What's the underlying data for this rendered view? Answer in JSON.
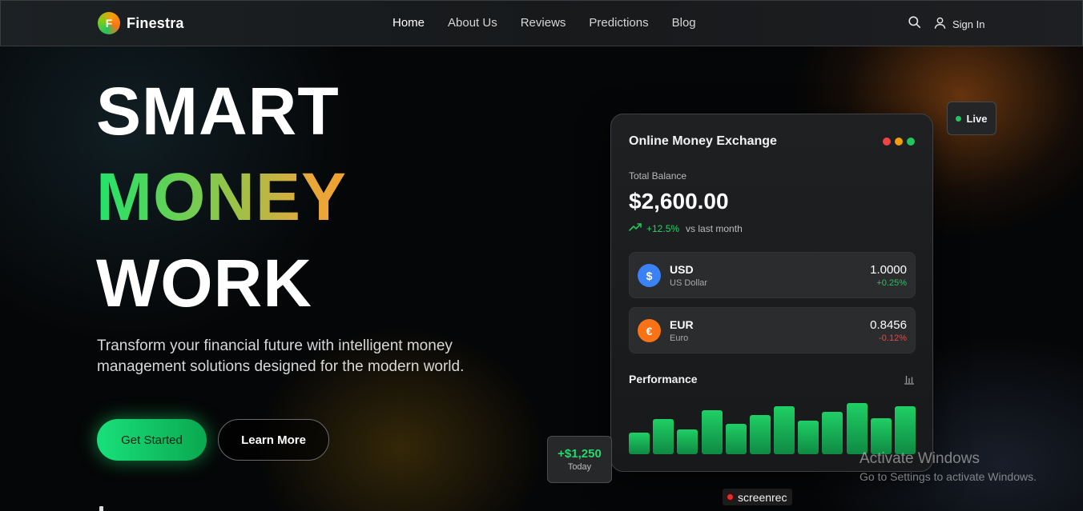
{
  "nav": {
    "brand_letter": "F",
    "brand_name": "Finestra",
    "links": [
      "Home",
      "About Us",
      "Reviews",
      "Predictions",
      "Blog"
    ],
    "active_link": "Home",
    "sign_in": "Sign In",
    "icons": [
      "search-icon",
      "user-icon"
    ]
  },
  "hero": {
    "line1": "SMART",
    "line2": "MONEY",
    "line3": "WORK",
    "description": "Transform your financial future with intelligent money management solutions designed for the modern world.",
    "primary_button": "Get Started",
    "secondary_button": "Learn More"
  },
  "card": {
    "title": "Online Money Exchange",
    "window_dot_colors": [
      "#ef4444",
      "#f59e0b",
      "#22c55e"
    ],
    "balance_label": "Total Balance",
    "balance_value": "$2,600.00",
    "change_pct": "+12.5%",
    "change_note": "vs last month",
    "currencies": [
      {
        "code": "USD",
        "name": "US Dollar",
        "symbol": "$",
        "rate": "1.0000",
        "change": "+0.25%",
        "icon_color": "#3b82f6",
        "change_color": "#22c55e"
      },
      {
        "code": "EUR",
        "name": "Euro",
        "symbol": "€",
        "rate": "0.8456",
        "change": "-0.12%",
        "icon_color": "#f97316",
        "change_color": "#ef4444"
      }
    ],
    "performance_title": "Performance",
    "performance_levels": [
      0.38,
      0.63,
      0.44,
      0.79,
      0.54,
      0.7,
      0.86,
      0.6,
      0.75,
      0.91,
      0.64,
      0.86
    ]
  },
  "badges": {
    "live": "Live",
    "today_value": "+$1,250",
    "today_label": "Today"
  },
  "overlays": {
    "activate_title": "Activate Windows",
    "activate_sub": "Go to Settings to activate Windows.",
    "screenrec": "screenrec"
  },
  "colors": {
    "accent": "#22c55e",
    "background": "#050607"
  }
}
